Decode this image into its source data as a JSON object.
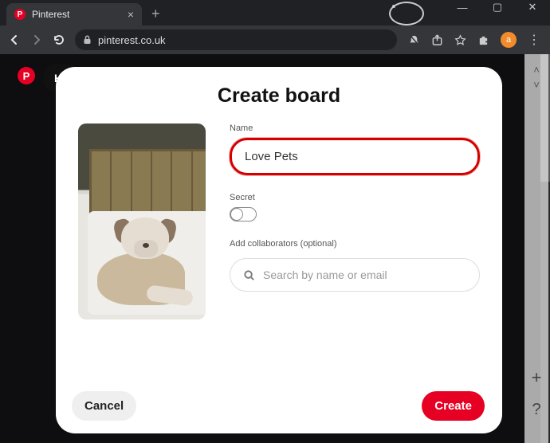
{
  "browser": {
    "tab_title": "Pinterest",
    "url_display": "pinterest.co.uk",
    "avatar_letter": "a"
  },
  "page": {
    "logo_letter": "P",
    "home_label": "Ho"
  },
  "modal": {
    "title": "Create board",
    "name_label": "Name",
    "name_value": "Love Pets",
    "secret_label": "Secret",
    "collaborators_label": "Add collaborators (optional)",
    "search_placeholder": "Search by name or email",
    "cancel_label": "Cancel",
    "create_label": "Create"
  },
  "rail": {
    "chev_up": "˄",
    "chev_down": "˅",
    "plus": "+",
    "question": "?"
  }
}
